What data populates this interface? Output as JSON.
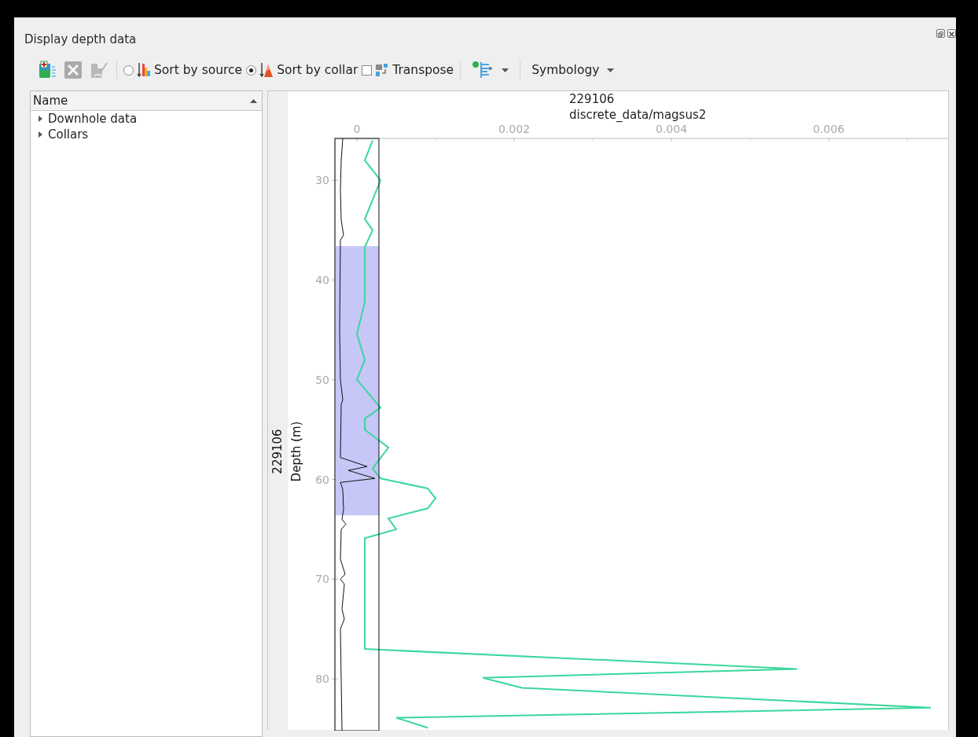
{
  "window": {
    "title": "Display depth data"
  },
  "toolbar": [
    {
      "kind": "icon_button",
      "disabled": false
    },
    {
      "kind": "icon_button",
      "disabled": true
    },
    {
      "kind": "icon_button",
      "disabled": true
    },
    {
      "kind": "separator"
    },
    {
      "kind": "radio",
      "label": "Sort by source",
      "selected": false
    },
    {
      "kind": "radio",
      "label": "Sort by collar",
      "selected": true
    },
    {
      "kind": "checkbox",
      "label": "Transpose",
      "checked": false
    },
    {
      "kind": "separator"
    },
    {
      "kind": "dropdown_icon"
    },
    {
      "kind": "separator"
    },
    {
      "kind": "dropdown",
      "label": "Symbology"
    }
  ],
  "tree": {
    "header": "Name",
    "items": [
      {
        "label": "Downhole data",
        "expanded": false
      },
      {
        "label": "Collars",
        "expanded": false
      }
    ]
  },
  "plot": {
    "side_labels": [
      "229106"
    ],
    "chart_data": {
      "type": "line",
      "title": "229106",
      "ylabel": "Depth (m)",
      "xlim": [
        -0.00028,
        0.00753
      ],
      "ylim": [
        85.2,
        25.8
      ],
      "xticks": [
        0,
        0.002,
        0.004,
        0.006
      ],
      "yticks": [
        30,
        40,
        50,
        60,
        70,
        80
      ],
      "x": [
        0.0002,
        0.0001,
        0.0003,
        0.0001,
        0.0002,
        0.0001,
        0.0001,
        0.0,
        0.0001,
        0.0,
        0.0003,
        0.0001,
        0.0001,
        0.0004,
        0.0002,
        0.0003,
        0.0009,
        0.001,
        0.0009,
        0.0004,
        0.0005,
        0.0001,
        0.0001,
        0.0001,
        0.0001,
        0.0001,
        0.0001,
        0.0056,
        0.0016,
        0.0021,
        0.0073,
        0.0005,
        0.0009
      ],
      "series": [
        {
          "name": "discrete_data/magsus2",
          "color": "#3ad79c",
          "values": [
            26,
            28,
            30,
            33.9,
            35,
            36.7,
            42.2,
            45.4,
            48,
            50,
            52.8,
            53.9,
            55,
            56.8,
            58.9,
            59.9,
            60.9,
            61.9,
            62.9,
            63.9,
            65,
            65.9,
            69,
            72,
            73.1,
            73.8,
            77,
            79,
            79.9,
            80.9,
            82.9,
            83.9,
            84.9
          ]
        }
      ],
      "bands": [
        {
          "axis": "y",
          "from": 36.6,
          "to": 63.6,
          "color": "#c6c6f7"
        }
      ]
    }
  }
}
